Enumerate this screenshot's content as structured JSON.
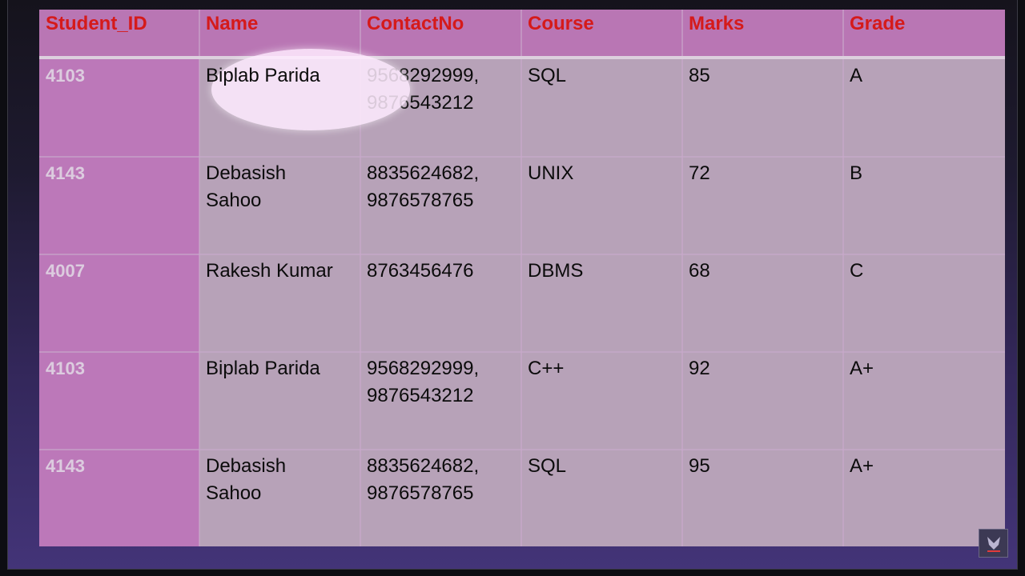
{
  "table": {
    "headers": [
      "Student_ID",
      "Name",
      "ContactNo",
      "Course",
      "Marks",
      "Grade"
    ],
    "rows": [
      {
        "id": "4103",
        "name": "Biplab Parida",
        "contact": "9568292999, 9876543212",
        "course": "SQL",
        "marks": "85",
        "grade": "A"
      },
      {
        "id": "4143",
        "name": "Debasish Sahoo",
        "contact": "8835624682, 9876578765",
        "course": "UNIX",
        "marks": "72",
        "grade": "B"
      },
      {
        "id": "4007",
        "name": "Rakesh Kumar",
        "contact": "8763456476",
        "course": "DBMS",
        "marks": "68",
        "grade": "C"
      },
      {
        "id": "4103",
        "name": "Biplab Parida",
        "contact": "9568292999, 9876543212",
        "course": "C++",
        "marks": "92",
        "grade": "A+"
      },
      {
        "id": "4143",
        "name": "Debasish Sahoo",
        "contact": "8835624682, 9876578765",
        "course": "SQL",
        "marks": "95",
        "grade": "A+"
      }
    ]
  },
  "highlight": {
    "row": 0,
    "column": "name"
  },
  "colors": {
    "header_text": "#d51a1a",
    "header_bg": "#b976b4",
    "id_column_bg": "#bc78b9",
    "body_bg": "#b7a2b8"
  },
  "logo": {
    "icon": "channel-logo-icon"
  }
}
